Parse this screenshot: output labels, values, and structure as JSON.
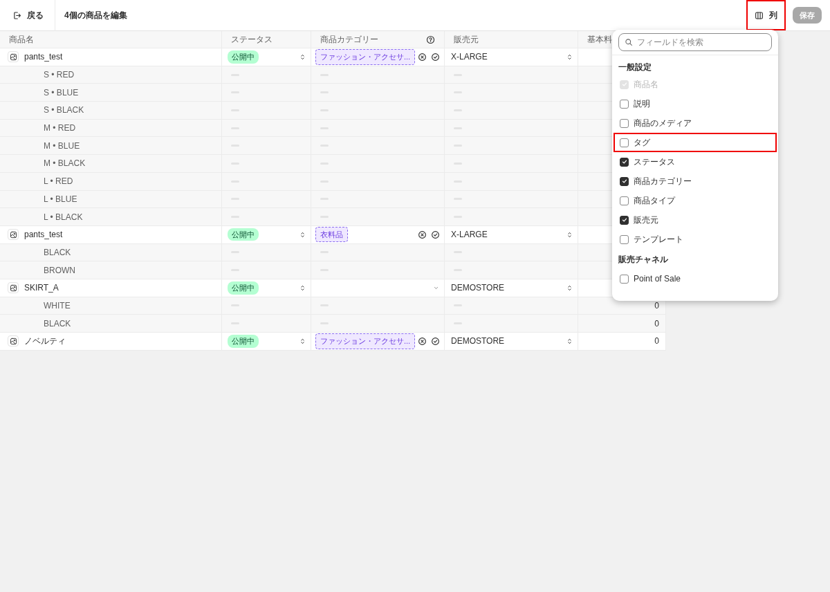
{
  "header": {
    "back_button": "戻る",
    "title": "4個の商品を編集",
    "columns_button": {
      "label": "列",
      "highlighted": true
    },
    "save_button": {
      "label": "保存",
      "disabled": true
    }
  },
  "table": {
    "columns": [
      {
        "label": "商品名"
      },
      {
        "label": "ステータス"
      },
      {
        "label": "商品カテゴリー",
        "help": true
      },
      {
        "label": "販売元"
      },
      {
        "label": "基本料"
      }
    ],
    "rows": [
      {
        "kind": "product",
        "name": "pants_test",
        "status": "公開中",
        "category": "ファッション・アクセサ...",
        "vendor": "X-LARGE"
      },
      {
        "kind": "variant",
        "name": "S • RED"
      },
      {
        "kind": "variant",
        "name": "S • BLUE"
      },
      {
        "kind": "variant",
        "name": "S • BLACK"
      },
      {
        "kind": "variant",
        "name": "M • RED"
      },
      {
        "kind": "variant",
        "name": "M • BLUE"
      },
      {
        "kind": "variant",
        "name": "M • BLACK"
      },
      {
        "kind": "variant",
        "name": "L • RED"
      },
      {
        "kind": "variant",
        "name": "L • BLUE"
      },
      {
        "kind": "variant",
        "name": "L • BLACK"
      },
      {
        "kind": "product",
        "name": "pants_test",
        "status": "公開中",
        "category": "衣料品",
        "vendor": "X-LARGE"
      },
      {
        "kind": "variant",
        "name": "BLACK"
      },
      {
        "kind": "variant",
        "name": "BROWN"
      },
      {
        "kind": "product",
        "name": "SKIRT_A",
        "status": "公開中",
        "vendor": "DEMOSTORE"
      },
      {
        "kind": "variant",
        "name": "WHITE",
        "price": "0"
      },
      {
        "kind": "variant",
        "name": "BLACK",
        "price": "0"
      },
      {
        "kind": "product",
        "name": "ノベルティ",
        "status": "公開中",
        "category": "ファッション・アクセサ...",
        "vendor": "DEMOSTORE",
        "price": "0"
      }
    ]
  },
  "column_picker": {
    "search": {
      "placeholder": "フィールドを検索"
    },
    "sections": [
      {
        "title": "一般設定",
        "items": [
          {
            "label": "商品名",
            "checked": true,
            "disabled": true,
            "highlighted": false
          },
          {
            "label": "説明",
            "checked": false,
            "disabled": false,
            "highlighted": false
          },
          {
            "label": "商品のメディア",
            "checked": false,
            "disabled": false,
            "highlighted": false
          },
          {
            "label": "タグ",
            "checked": false,
            "disabled": false,
            "highlighted": true
          },
          {
            "label": "ステータス",
            "checked": true,
            "disabled": false,
            "highlighted": false
          },
          {
            "label": "商品カテゴリー",
            "checked": true,
            "disabled": false,
            "highlighted": false
          },
          {
            "label": "商品タイプ",
            "checked": false,
            "disabled": false,
            "highlighted": false
          },
          {
            "label": "販売元",
            "checked": true,
            "disabled": false,
            "highlighted": false
          },
          {
            "label": "テンプレート",
            "checked": false,
            "disabled": false,
            "highlighted": false
          }
        ]
      },
      {
        "title": "販売チャネル",
        "items": [
          {
            "label": "Point of Sale",
            "checked": false,
            "disabled": false,
            "highlighted": false
          }
        ]
      }
    ]
  }
}
